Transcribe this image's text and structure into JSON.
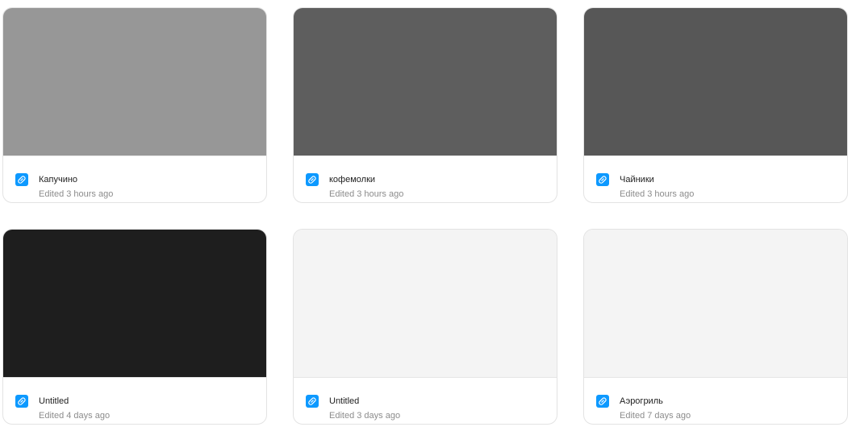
{
  "files": [
    {
      "title": "Капучино",
      "edited": "Edited 3 hours ago",
      "thumb_color": "#979797",
      "icon": "figjam-file-icon"
    },
    {
      "title": "кофемолки",
      "edited": "Edited 3 hours ago",
      "thumb_color": "#5e5e5e",
      "icon": "figjam-file-icon"
    },
    {
      "title": "Чайники",
      "edited": "Edited 3 hours ago",
      "thumb_color": "#575757",
      "icon": "figjam-file-icon"
    },
    {
      "title": "Untitled",
      "edited": "Edited 4 days ago",
      "thumb_color": "#1e1e1e",
      "icon": "figjam-file-icon"
    },
    {
      "title": "Untitled",
      "edited": "Edited 3 days ago",
      "thumb_color": "#f4f4f4",
      "icon": "figjam-file-icon"
    },
    {
      "title": "Аэрогриль",
      "edited": "Edited 7 days ago",
      "thumb_color": "#f4f4f4",
      "icon": "figjam-file-icon"
    }
  ],
  "colors": {
    "icon_bg": "#0d99ff",
    "title_text": "#1e1e1e",
    "meta_text": "#8c8c8c"
  }
}
